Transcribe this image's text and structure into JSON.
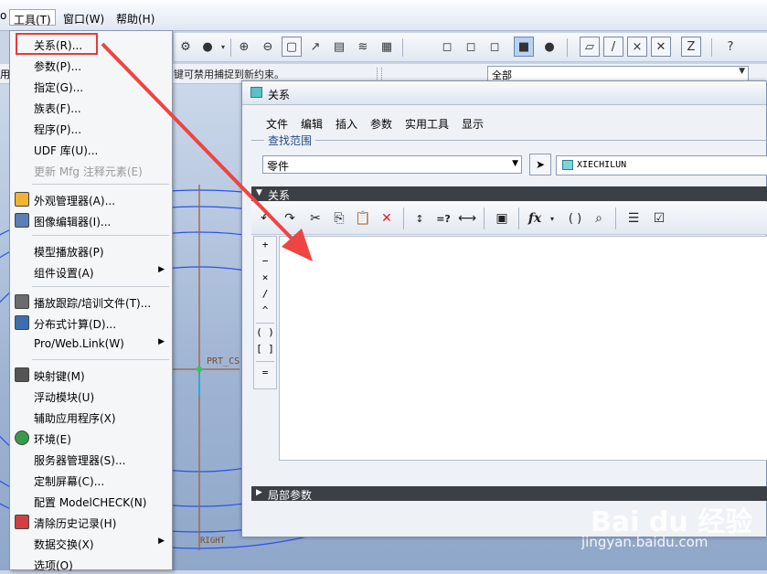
{
  "menubar": {
    "edge_char": "o",
    "items": [
      {
        "label": "工具(T)"
      },
      {
        "label": "窗口(W)"
      },
      {
        "label": "帮助(H)"
      }
    ]
  },
  "status": {
    "left_char": "用",
    "message": "键可禁用捕捉到新约束。",
    "filter_value": "全部"
  },
  "graphics": {
    "csys_label": "PRT_CS",
    "datum_label": "RIGHT"
  },
  "tools_menu": {
    "items": [
      {
        "label": "关系(R)...",
        "icon": "",
        "submenu": false,
        "disabled": false
      },
      {
        "label": "参数(P)...",
        "icon": "",
        "submenu": false,
        "disabled": false
      },
      {
        "label": "指定(G)...",
        "icon": "",
        "submenu": false,
        "disabled": false
      },
      {
        "label": "族表(F)...",
        "icon": "",
        "submenu": false,
        "disabled": false
      },
      {
        "label": "程序(P)...",
        "icon": "",
        "submenu": false,
        "disabled": false
      },
      {
        "label": "UDF 库(U)...",
        "icon": "",
        "submenu": false,
        "disabled": false
      },
      {
        "label": "更新 Mfg 注释元素(E)",
        "icon": "",
        "submenu": false,
        "disabled": true
      },
      {
        "label": "外观管理器(A)...",
        "icon": "appearance-icon",
        "submenu": false,
        "disabled": false
      },
      {
        "label": "图像编辑器(I)...",
        "icon": "image-editor-icon",
        "submenu": false,
        "disabled": false
      },
      {
        "label": "模型播放器(P)",
        "icon": "",
        "submenu": false,
        "disabled": false
      },
      {
        "label": "组件设置(A)",
        "icon": "",
        "submenu": true,
        "disabled": false
      },
      {
        "label": "播放跟踪/培训文件(T)...",
        "icon": "trail-icon",
        "submenu": false,
        "disabled": false
      },
      {
        "label": "分布式计算(D)...",
        "icon": "distributed-icon",
        "submenu": false,
        "disabled": false
      },
      {
        "label": "Pro/Web.Link(W)",
        "icon": "",
        "submenu": true,
        "disabled": false
      },
      {
        "label": "映射键(M)",
        "icon": "mapkey-icon",
        "submenu": false,
        "disabled": false
      },
      {
        "label": "浮动模块(U)",
        "icon": "",
        "submenu": false,
        "disabled": false
      },
      {
        "label": "辅助应用程序(X)",
        "icon": "",
        "submenu": false,
        "disabled": false
      },
      {
        "label": "环境(E)",
        "icon": "globe-icon",
        "submenu": false,
        "disabled": false
      },
      {
        "label": "服务器管理器(S)...",
        "icon": "",
        "submenu": false,
        "disabled": false
      },
      {
        "label": "定制屏幕(C)...",
        "icon": "",
        "submenu": false,
        "disabled": false
      },
      {
        "label": "配置 ModelCHECK(N)",
        "icon": "",
        "submenu": false,
        "disabled": false
      },
      {
        "label": "清除历史记录(H)",
        "icon": "clear-history-icon",
        "submenu": false,
        "disabled": false
      },
      {
        "label": "数据交换(X)",
        "icon": "",
        "submenu": true,
        "disabled": false
      },
      {
        "label": "选项(O)",
        "icon": "",
        "submenu": false,
        "disabled": false
      }
    ]
  },
  "relations_dialog": {
    "title": "关系",
    "menus": [
      "文件",
      "编辑",
      "插入",
      "参数",
      "实用工具",
      "显示"
    ],
    "scope_label": "查找范围",
    "scope_value": "零件",
    "model_name": "XIECHILUN",
    "relations_section": "关系",
    "local_params_section": "局部参数",
    "toolbar_glyphs": {
      "fx": "fx",
      "eq_check": "=?",
      "brackets": "( )"
    },
    "operators": [
      "+",
      "−",
      "×",
      "/",
      "^",
      "( )",
      "[ ]",
      "="
    ],
    "relations_text": ""
  },
  "watermark": {
    "brand": "Bai du 经验",
    "url": "jingyan.baidu.com"
  },
  "colors": {
    "highlight": "#e53b3b",
    "section_bar": "#3b3f46",
    "graphics_bg": "#a9bcd9"
  }
}
